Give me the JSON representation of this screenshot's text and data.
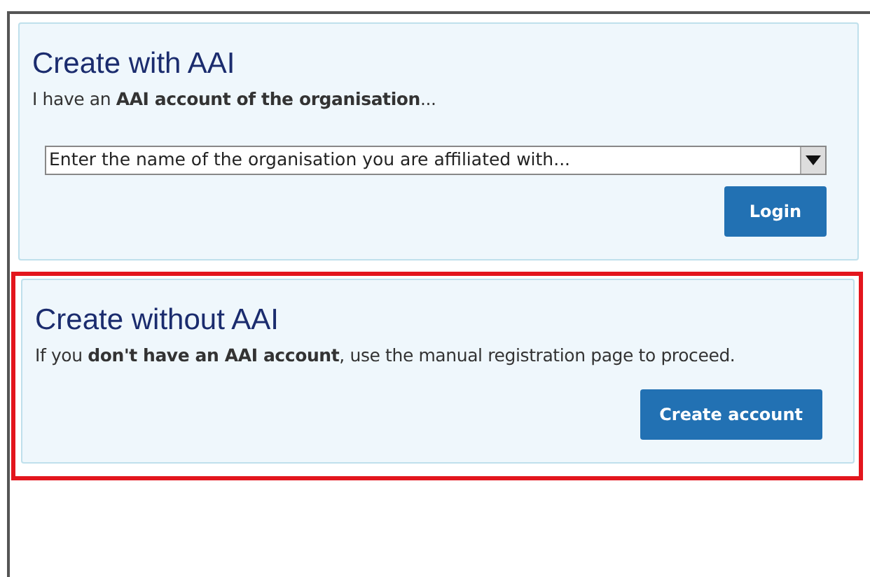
{
  "panels": [
    {
      "title": "Create with AAI",
      "text": "I have an **AAI account of the organisation**...",
      "field": {
        "placeholder": "Enter the name of the organisation you are affiliated with..."
      },
      "button": "Login",
      "highlighted": false
    },
    {
      "title": "Create without AAI",
      "text": "If you **don't have an AAI account**, use the manual registration page to proceed.",
      "button": "Create account",
      "highlighted": true
    }
  ]
}
